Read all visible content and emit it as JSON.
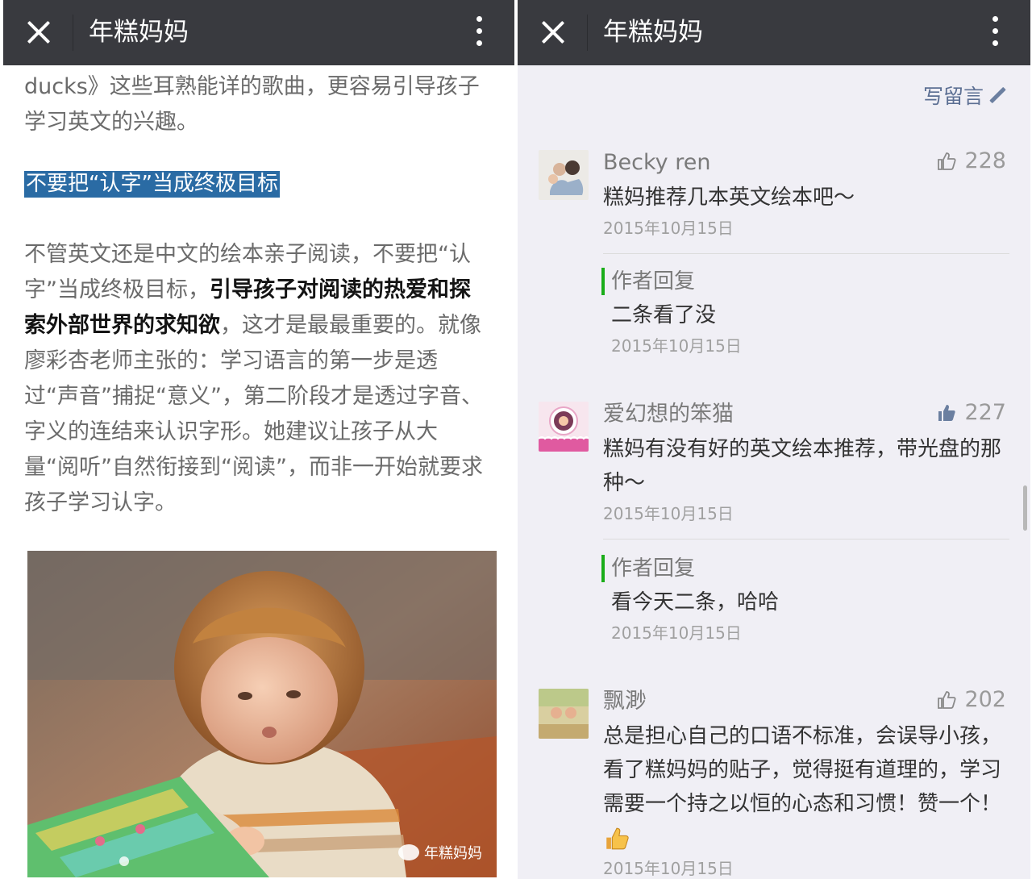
{
  "left": {
    "topbar": {
      "title": "年糕妈妈"
    },
    "article": {
      "intro": "ducks》这些耳熟能详的歌曲，更容易引导孩子学习英文的兴趣。",
      "heading": "不要把“认字”当成终极目标",
      "para_part1": "不管英文还是中文的绘本亲子阅读，不要把“认字”当成终极目标，",
      "para_bold": "引导孩子对阅读的热爱和探索外部世界的求知欲",
      "para_part2": "，这才是最最重要的。就像廖彩杏老师主张的：学习语言的第一步是透过“声音”捕捉“意义”，第二阶段才是透过字音、字义的连结来认识字形。她建议让孩子从大量“阅听”自然衔接到“阅读”，而非一开始就要求孩子学习认字。",
      "image_watermark": "年糕妈妈"
    }
  },
  "right": {
    "topbar": {
      "title": "年糕妈妈"
    },
    "write_comment_label": "写留言",
    "comments": [
      {
        "name": "Becky ren",
        "likes": "228",
        "text": "糕妈推荐几本英文绘本吧～",
        "date": "2015年10月15日",
        "reply_label": "作者回复",
        "reply_text": "二条看了没",
        "reply_date": "2015年10月15日"
      },
      {
        "name": "爱幻想的笨猫",
        "likes": "227",
        "text": "糕妈有没有好的英文绘本推荐，带光盘的那种～",
        "date": "2015年10月15日",
        "reply_label": "作者回复",
        "reply_text": "看今天二条，哈哈",
        "reply_date": "2015年10月15日"
      },
      {
        "name": "飘渺",
        "likes": "202",
        "text": "总是担心自己的口语不标准，会误导小孩，看了糕妈妈的贴子，觉得挺有道理的，学习需要一个持之以恒的心态和习惯！赞一个！",
        "date": "2015年10月15日"
      }
    ]
  },
  "colors": {
    "topbar": "#393a3f",
    "heading_highlight": "#2a6ba4",
    "reply_bar": "#1aad19",
    "comments_bg": "#f0eff5",
    "link": "#5c6f93"
  }
}
